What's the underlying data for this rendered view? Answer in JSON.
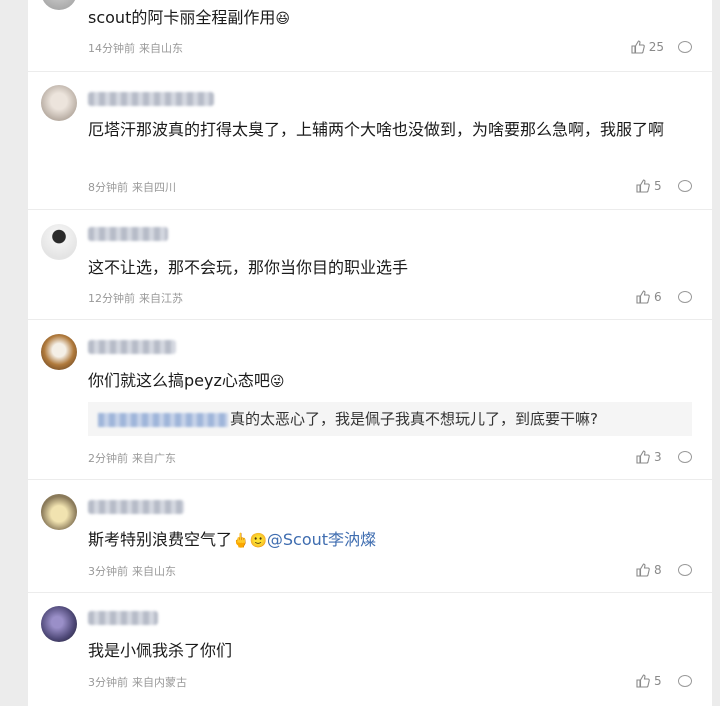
{
  "comments": [
    {
      "text": "scout的阿卡丽全程副作用",
      "emoji": "😆",
      "time": "14分钟前",
      "location": "来自山东",
      "likes": "25"
    },
    {
      "text": "厄塔汗那波真的打得太臭了，上辅两个大啥也没做到，为啥要那么急啊，我服了啊",
      "time": "8分钟前",
      "location": "来自四川",
      "likes": "5"
    },
    {
      "text": "这不让选，那不会玩，那你当你目的职业选手",
      "time": "12分钟前",
      "location": "来自江苏",
      "likes": "6"
    },
    {
      "text": "你们就这么搞peyz心态吧",
      "emoji": "😜",
      "quote_text": "真的太恶心了，我是佩子我真不想玩儿了，到底要干嘛?",
      "time": "2分钟前",
      "location": "来自广东",
      "likes": "3"
    },
    {
      "text": "斯考特别浪费空气了",
      "emoji": "🖕🙂",
      "mention": "@Scout李汭燦",
      "time": "3分钟前",
      "location": "来自山东",
      "likes": "8"
    },
    {
      "text": "我是小佩我杀了你们",
      "time": "3分钟前",
      "location": "来自内蒙古",
      "likes": "5"
    }
  ],
  "colors": {
    "mention": "#3f6db0",
    "meta": "#999999",
    "text": "#1a1a1a"
  },
  "icons": {
    "like": "thumbs-up-icon",
    "comment": "comment-bubble-icon"
  }
}
